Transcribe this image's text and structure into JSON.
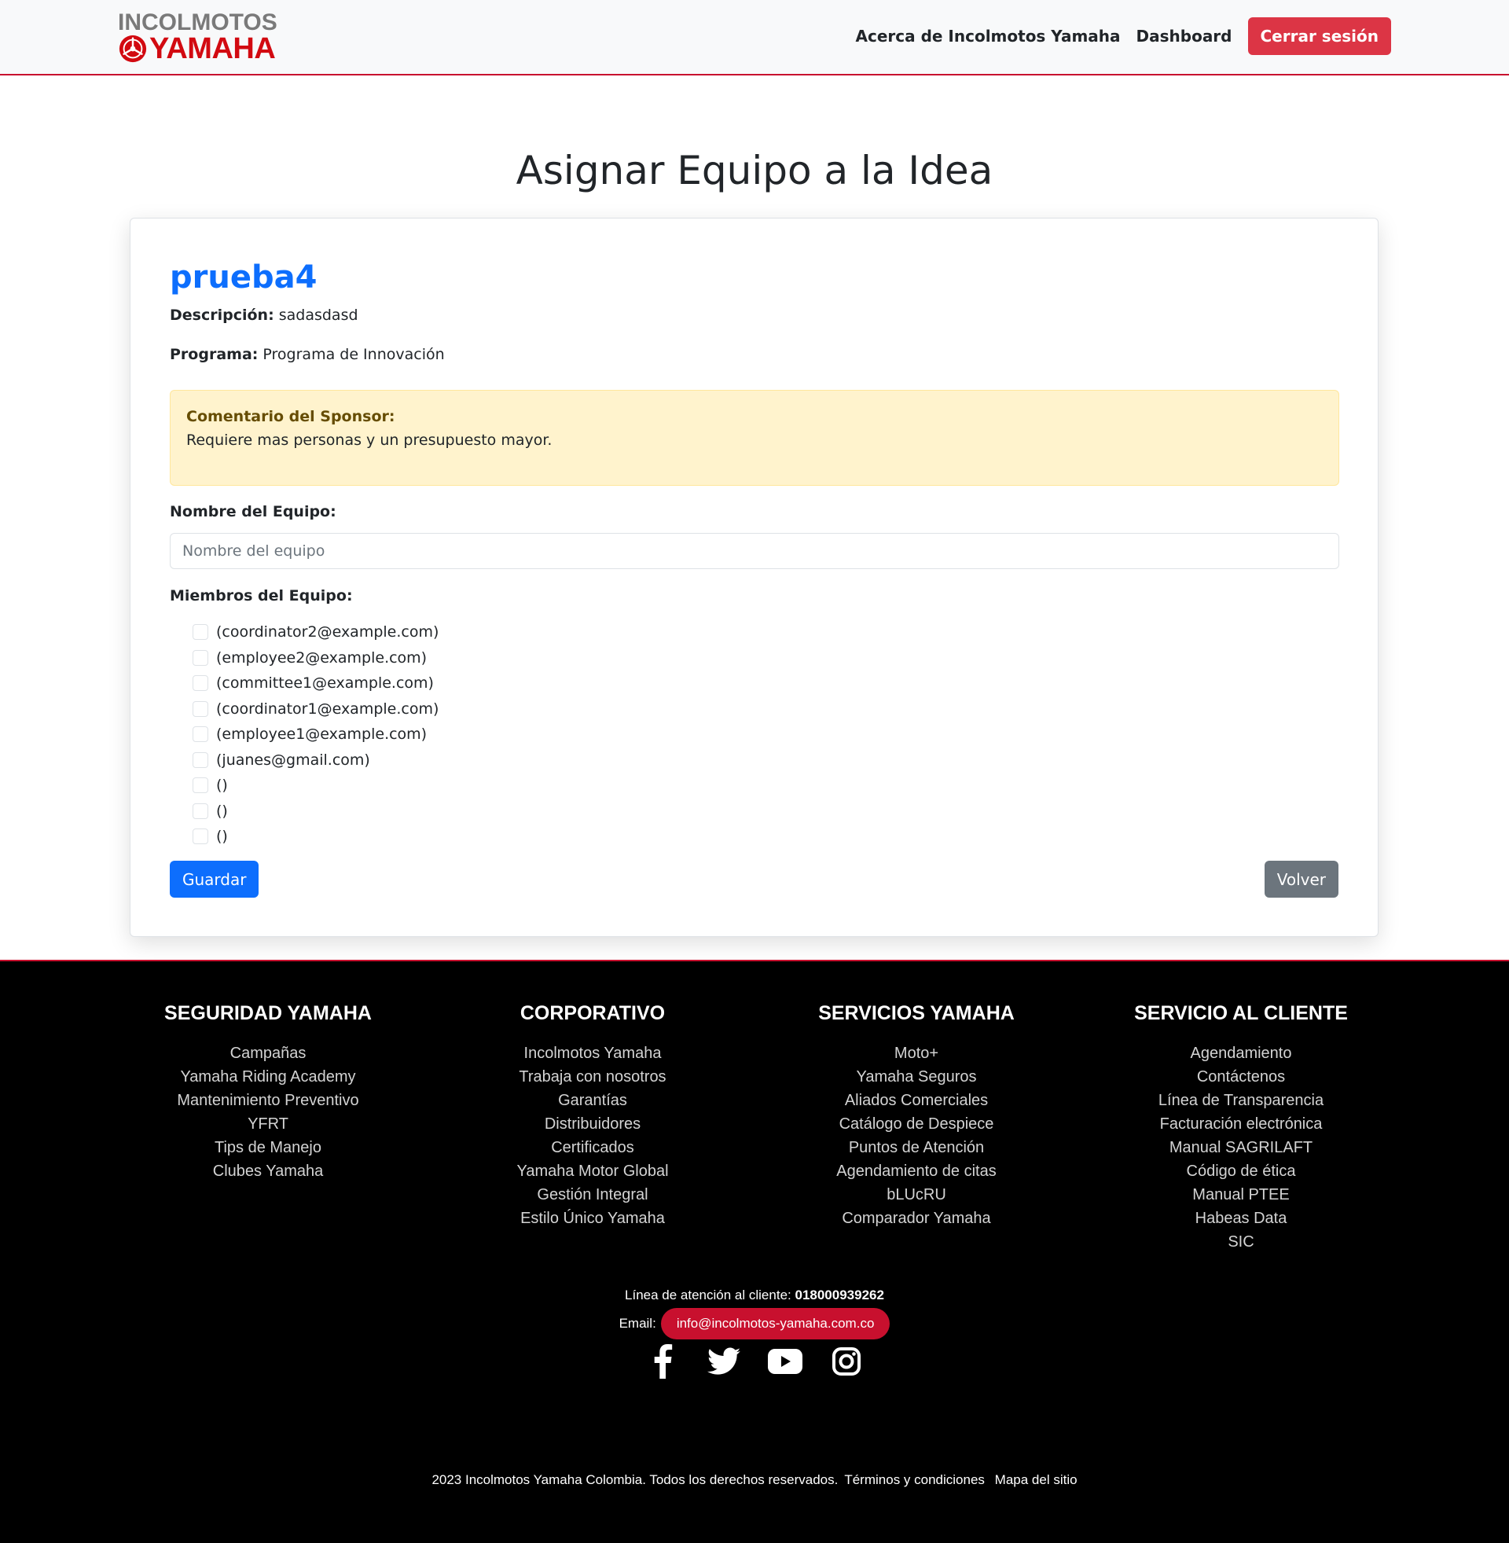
{
  "header": {
    "logo_top": "INCOLMOTOS",
    "logo_bottom": "YAMAHA",
    "nav": {
      "about": "Acerca de Incolmotos Yamaha",
      "dashboard": "Dashboard",
      "logout": "Cerrar sesión"
    }
  },
  "page_title": "Asignar Equipo a la Idea",
  "idea": {
    "title": "prueba4",
    "description_label": "Descripción:",
    "description": "sadasdasd",
    "program_label": "Programa:",
    "program": "Programa de Innovación"
  },
  "sponsor_alert": {
    "title": "Comentario del Sponsor:",
    "text": "Requiere mas personas y un presupuesto mayor."
  },
  "form": {
    "team_name_label": "Nombre del Equipo:",
    "team_name_value": "",
    "team_name_placeholder": "Nombre del equipo",
    "members_label": "Miembros del Equipo:",
    "members": [
      {
        "label": "(coordinator2@example.com)",
        "checked": false
      },
      {
        "label": "(employee2@example.com)",
        "checked": false
      },
      {
        "label": "(committee1@example.com)",
        "checked": false
      },
      {
        "label": "(coordinator1@example.com)",
        "checked": false
      },
      {
        "label": "(employee1@example.com)",
        "checked": false
      },
      {
        "label": "(juanes@gmail.com)",
        "checked": false
      },
      {
        "label": "()",
        "checked": false
      },
      {
        "label": "()",
        "checked": false
      },
      {
        "label": "()",
        "checked": false
      }
    ],
    "save_label": "Guardar",
    "back_label": "Volver"
  },
  "footer": {
    "columns": [
      {
        "title": "SEGURIDAD YAMAHA",
        "links": [
          "Campañas",
          "Yamaha Riding Academy",
          "Mantenimiento Preventivo",
          "YFRT",
          "Tips de Manejo",
          "Clubes Yamaha"
        ]
      },
      {
        "title": "CORPORATIVO",
        "links": [
          "Incolmotos Yamaha",
          "Trabaja con nosotros",
          "Garantías",
          "Distribuidores",
          "Certificados",
          "Yamaha Motor Global",
          "Gestión Integral",
          "Estilo Único Yamaha"
        ]
      },
      {
        "title": "SERVICIOS YAMAHA",
        "links": [
          "Moto+",
          "Yamaha Seguros",
          "Aliados Comerciales",
          "Catálogo de Despiece",
          "Puntos de Atención",
          "Agendamiento de citas",
          "bLUcRU",
          "Comparador Yamaha"
        ]
      },
      {
        "title": "SERVICIO AL CLIENTE",
        "links": [
          "Agendamiento",
          "Contáctenos",
          "Línea de Transparencia",
          "Facturación electrónica",
          "Manual SAGRILAFT",
          "Código de ética",
          "Manual PTEE",
          "Habeas Data",
          "SIC"
        ]
      }
    ],
    "phone_label": "Línea de atención al cliente:",
    "phone": "018000939262",
    "email_label": "Email:",
    "email": "info@incolmotos-yamaha.com.co",
    "socials": [
      "facebook-icon",
      "twitter-icon",
      "youtube-icon",
      "instagram-icon"
    ],
    "copyright": "2023 Incolmotos Yamaha Colombia. Todos los derechos reservados.",
    "terms": "Términos y condiciones",
    "sitemap": "Mapa del sitio"
  },
  "colors": {
    "brand_red": "#c8102e",
    "primary_blue": "#0d6efd",
    "secondary_gray": "#6c757d",
    "alert_bg": "#fff3cd",
    "danger": "#dc3545"
  }
}
